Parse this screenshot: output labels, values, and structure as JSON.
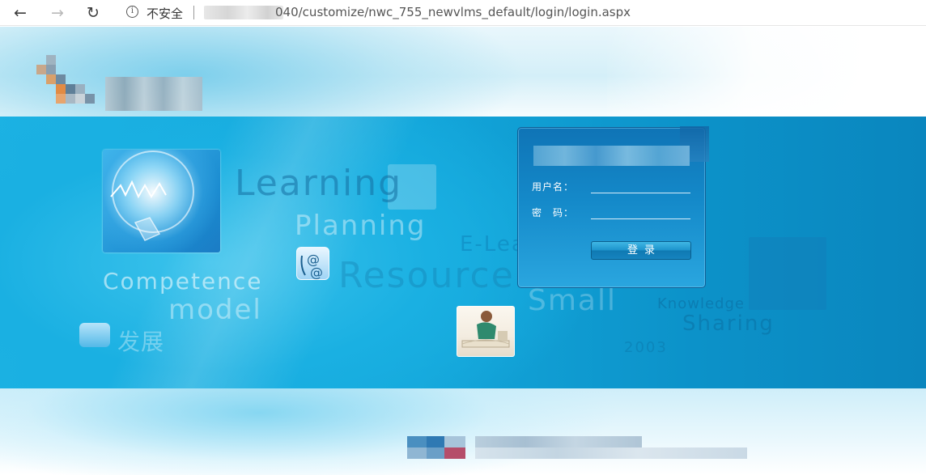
{
  "browser": {
    "back_icon": "←",
    "forward_icon": "→",
    "reload_icon": "↻",
    "info_icon": "i",
    "security_label": "不安全",
    "url": "040/customize/nwc_755_newvlms_default/login/login.aspx"
  },
  "decor": {
    "learning": "Learning",
    "planning": "Planning",
    "elearning": "E-Learning",
    "resource": "Resource",
    "small": "Small",
    "knowledge": "Knowledge",
    "sharing": "Sharing",
    "year": "2003",
    "competence": "Competence",
    "model": "model",
    "fazhan": "发展"
  },
  "login": {
    "username_label": "用户名：",
    "password_label": "密　码：",
    "username_value": "",
    "password_value": "",
    "submit_label": "登录"
  },
  "colors": {
    "accent": "#13a6da",
    "panel": "#1489c9"
  }
}
